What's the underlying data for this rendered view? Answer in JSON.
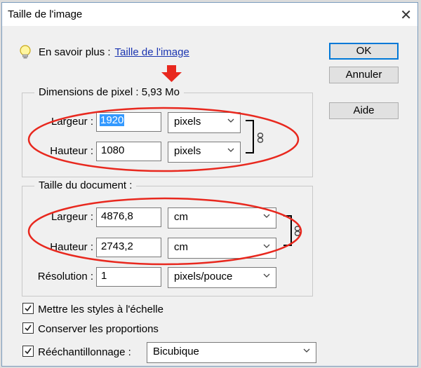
{
  "window": {
    "title": "Taille de l'image",
    "close_glyph": "✕"
  },
  "info": {
    "prefix": "En savoir plus :",
    "link": "Taille de l'image"
  },
  "buttons": {
    "ok": "OK",
    "cancel": "Annuler",
    "help": "Aide"
  },
  "pixel_dimensions": {
    "legend": "Dimensions de pixel : 5,93 Mo",
    "width_label": "Largeur :",
    "width_value": "1920",
    "width_unit": "pixels",
    "height_label": "Hauteur :",
    "height_value": "1080",
    "height_unit": "pixels"
  },
  "document_size": {
    "legend": "Taille du document :",
    "width_label": "Largeur :",
    "width_value": "4876,8",
    "width_unit": "cm",
    "height_label": "Hauteur :",
    "height_value": "2743,2",
    "height_unit": "cm",
    "resolution_label": "Résolution :",
    "resolution_value": "1",
    "resolution_unit": "pixels/pouce"
  },
  "options": {
    "scale_styles": {
      "label": "Mettre les styles à l'échelle",
      "checked": true
    },
    "constrain": {
      "label": "Conserver les proportions",
      "checked": true
    },
    "resample": {
      "label": "Rééchantillonnage :",
      "checked": true,
      "method": "Bicubique"
    }
  },
  "colors": {
    "annotation": "#e8281e",
    "accent": "#0078d7",
    "link": "#1a34b0"
  }
}
